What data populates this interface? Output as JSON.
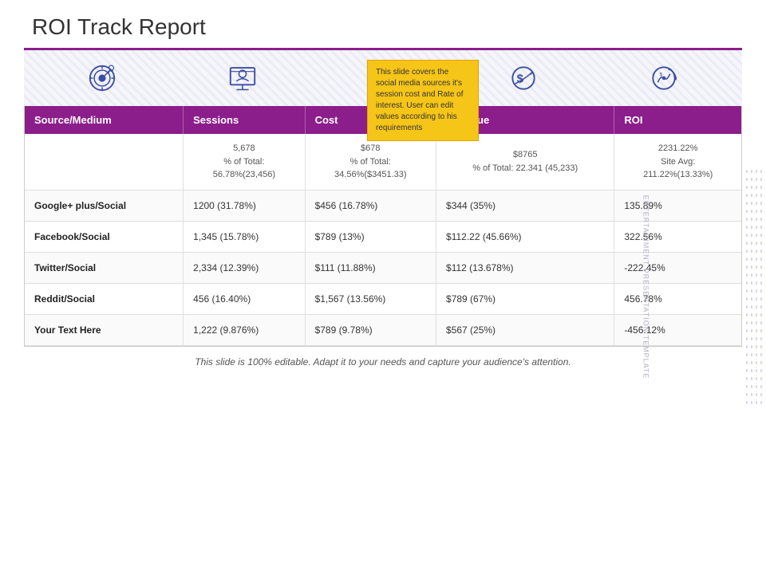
{
  "page": {
    "title": "ROI Track Report",
    "footer": "This slide is 100% editable. Adapt it to your needs and capture your audience's attention."
  },
  "tooltip": {
    "text": "This slide covers the social media sources it's session cost and Rate of interest. User can edit values according to his requirements"
  },
  "icons": [
    {
      "name": "target-icon",
      "label": "Target/Marketing"
    },
    {
      "name": "presentation-icon",
      "label": "Presentation"
    },
    {
      "name": "dollar-icon",
      "label": "Dollar/Cost"
    },
    {
      "name": "revenue-icon",
      "label": "Revenue"
    },
    {
      "name": "roi-icon",
      "label": "ROI"
    }
  ],
  "table": {
    "headers": [
      "Source/Medium",
      "Sessions",
      "Cost",
      "Revenue",
      "ROI"
    ],
    "total_row": {
      "source": "",
      "sessions": "5,678\n% of Total:\n56.78%(23,456)",
      "cost": "$678\n% of Total:\n34.56%($3451.33)",
      "revenue": "$8765\n% of Total: 22.341 (45,233)",
      "roi": "2231.22%\nSite Avg:\n211.22%(13.33%)"
    },
    "rows": [
      {
        "source": "Google+ plus/Social",
        "sessions": "1200 (31.78%)",
        "cost": "$456 (16.78%)",
        "revenue": "$344 (35%)",
        "roi": "135.89%"
      },
      {
        "source": "Facebook/Social",
        "sessions": "1,345 (15.78%)",
        "cost": "$789 (13%)",
        "revenue": "$112.22 (45.66%)",
        "roi": "322.56%"
      },
      {
        "source": "Twitter/Social",
        "sessions": "2,334 (12.39%)",
        "cost": "$111 (11.88%)",
        "revenue": "$112 (13.678%)",
        "roi": "-222.45%"
      },
      {
        "source": "Reddit/Social",
        "sessions": "456 (16.40%)",
        "cost": "$1,567 (13.56%)",
        "revenue": "$789 (67%)",
        "roi": "456.78%"
      },
      {
        "source": "Your Text Here",
        "sessions": "1,222 (9.876%)",
        "cost": "$789 (9.78%)",
        "revenue": "$567 (25%)",
        "roi": "-456.12%"
      }
    ]
  },
  "colors": {
    "header_bg": "#8B1E8B",
    "icon_color": "#3a4fa0",
    "accent": "#8B1E8B"
  }
}
